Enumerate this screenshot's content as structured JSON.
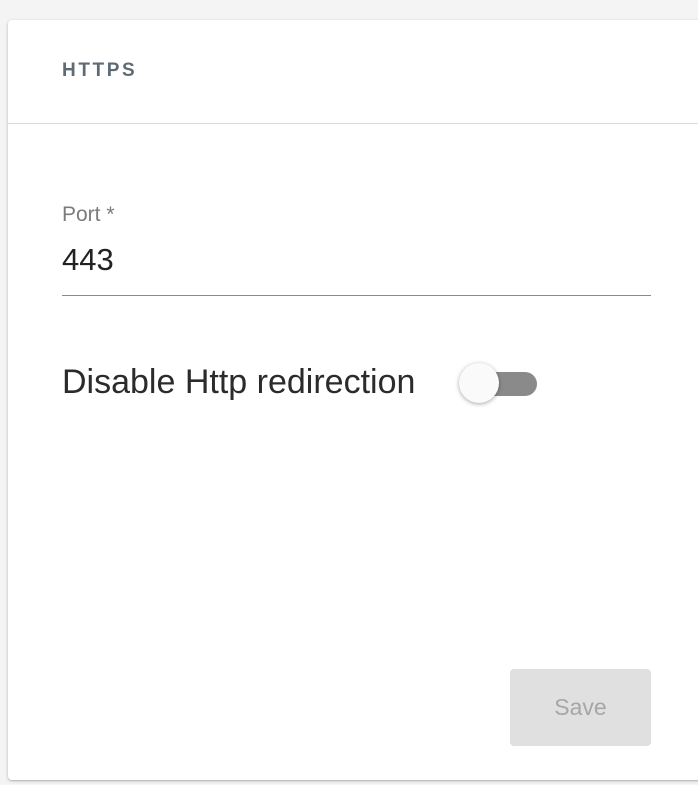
{
  "card": {
    "title": "HTTPS"
  },
  "port_field": {
    "label": "Port *",
    "value": "443"
  },
  "http_redirection_toggle": {
    "label": "Disable Http redirection",
    "checked": false
  },
  "actions": {
    "save_label": "Save",
    "save_enabled": false
  },
  "colors": {
    "title": "#5e6b75",
    "toggle_track": "#8a8a8a",
    "toggle_thumb": "#fafafa",
    "disabled_button_bg": "#e0e0e0",
    "disabled_button_text": "#a6a6a6"
  }
}
